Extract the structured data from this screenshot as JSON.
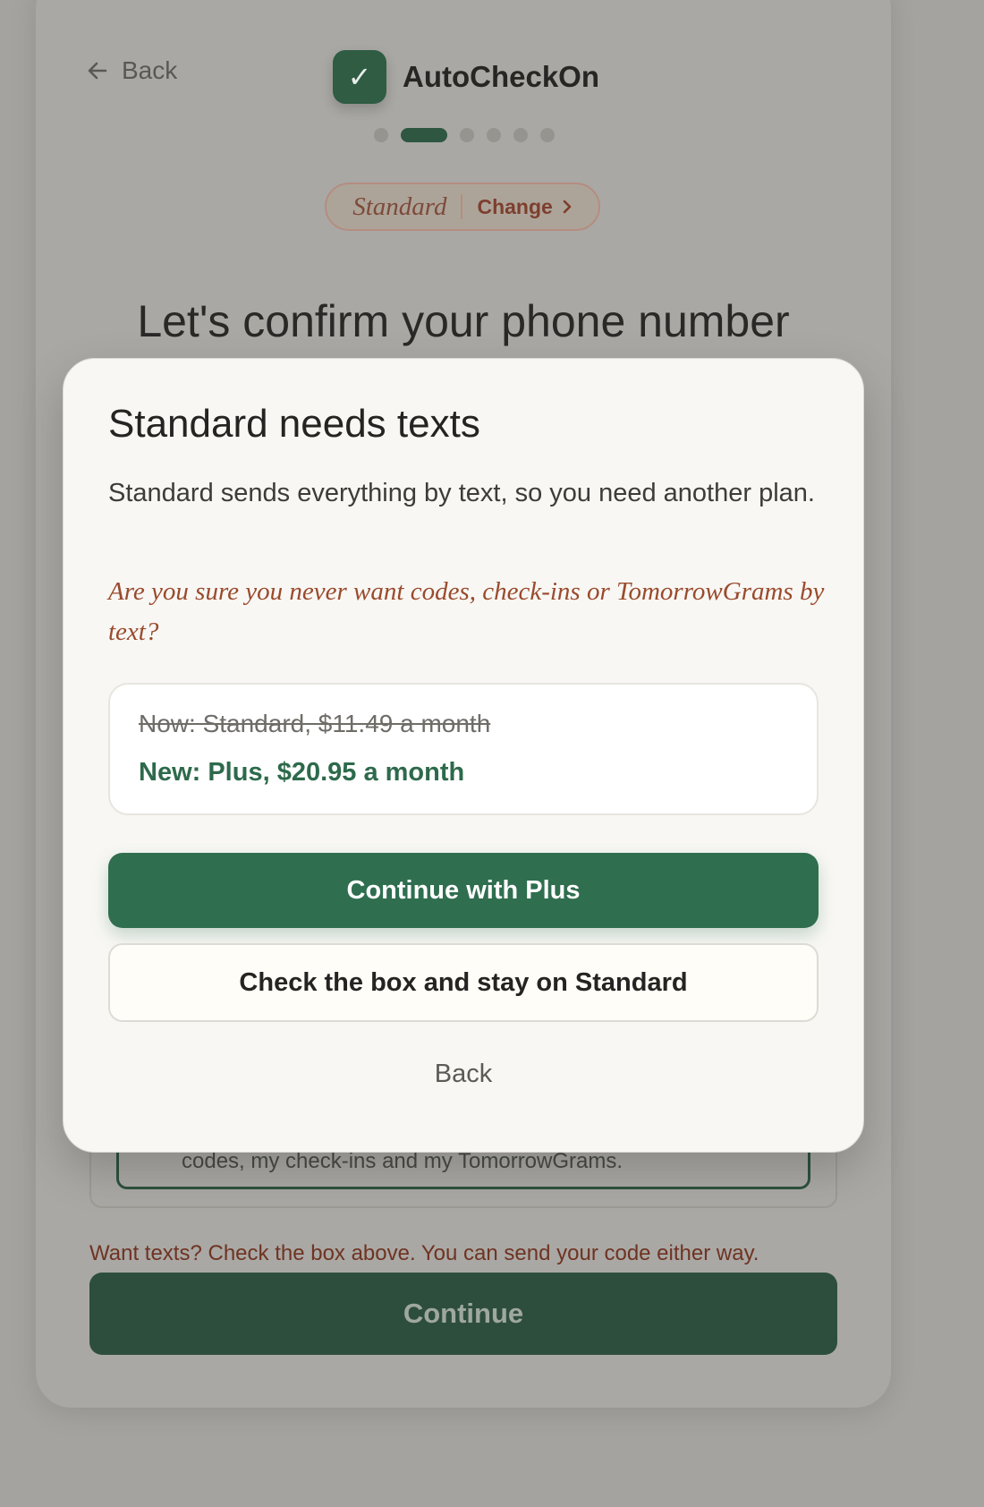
{
  "header": {
    "back_label": "Back",
    "app_name": "AutoCheckOn",
    "logo_glyph": "✓",
    "step_count": 6,
    "active_step": 2
  },
  "plan_pill": {
    "plan_name": "Standard",
    "change_label": "Change"
  },
  "page": {
    "title": "Let's confirm your phone number",
    "consent_text": "codes, my check-ins and my TomorrowGrams.",
    "hint": "Want texts? Check the box above. You can send your code either way.",
    "continue_label": "Continue"
  },
  "modal": {
    "title": "Standard needs texts",
    "description": "Standard sends everything by text, so you need another plan.",
    "warning": "Are you sure you never want codes, check-ins or TomorrowGrams by text?",
    "old_price": "Now: Standard, $11.49 a month",
    "new_price": "New: Plus, $20.95 a month",
    "primary_label": "Continue with Plus",
    "secondary_label": "Check the box and stay on Standard",
    "back_label": "Back"
  },
  "colors": {
    "brand_green": "#2f6e4f",
    "accent_rust": "#9a4a2c",
    "overlay": "#a4a3a0"
  }
}
